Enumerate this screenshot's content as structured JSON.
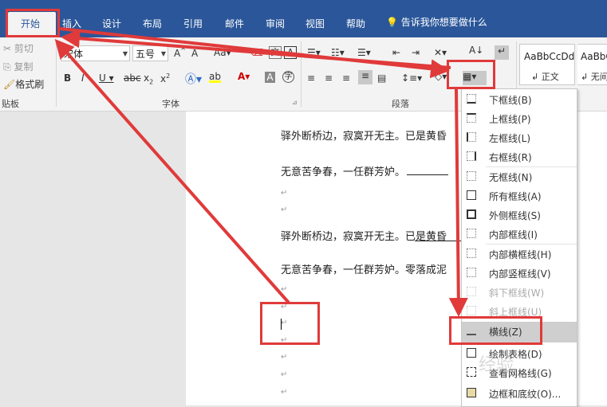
{
  "tabs": [
    "开始",
    "插入",
    "设计",
    "布局",
    "引用",
    "邮件",
    "审阅",
    "视图",
    "帮助"
  ],
  "tell_me": "告诉我你想要做什么",
  "clipboard": {
    "cut": "剪切",
    "copy": "复制",
    "format_painter": "格式刷",
    "label": "贴板"
  },
  "font": {
    "name": "宋体",
    "size": "五号",
    "label": "字体"
  },
  "paragraph": {
    "label": "段落"
  },
  "styles": [
    {
      "preview": "AaBbCcDd",
      "name": "↲ 正文"
    },
    {
      "preview": "AaBbC",
      "name": "↲ 无间"
    }
  ],
  "document": {
    "lines": [
      "驿外断桥边，寂寞开无主。已是黄昏",
      "无意苦争春，一任群芳妒。",
      "驿外断桥边，寂寞开无主。已是黄昏",
      "无意苦争春，一任群芳妒。零落成泥"
    ],
    "para_mark": "↵"
  },
  "border_menu": {
    "items": [
      {
        "label": "下框线(B)",
        "enabled": true
      },
      {
        "label": "上框线(P)",
        "enabled": true
      },
      {
        "label": "左框线(L)",
        "enabled": true
      },
      {
        "label": "右框线(R)",
        "enabled": true
      },
      {
        "label": "无框线(N)",
        "enabled": true
      },
      {
        "label": "所有框线(A)",
        "enabled": true
      },
      {
        "label": "外侧框线(S)",
        "enabled": true
      },
      {
        "label": "内部框线(I)",
        "enabled": true
      },
      {
        "label": "内部横框线(H)",
        "enabled": true
      },
      {
        "label": "内部竖框线(V)",
        "enabled": true
      },
      {
        "label": "斜下框线(W)",
        "enabled": false
      },
      {
        "label": "斜上框线(U)",
        "enabled": false
      },
      {
        "label": "横线(Z)",
        "enabled": true,
        "highlighted": true
      },
      {
        "label": "绘制表格(D)",
        "enabled": true
      },
      {
        "label": "查看网格线(G)",
        "enabled": true
      },
      {
        "label": "边框和底纹(O)...",
        "enabled": true
      }
    ]
  },
  "colors": {
    "ribbon_blue": "#2b579a",
    "annotation_red": "#e03a3a"
  },
  "watermark": "经验"
}
